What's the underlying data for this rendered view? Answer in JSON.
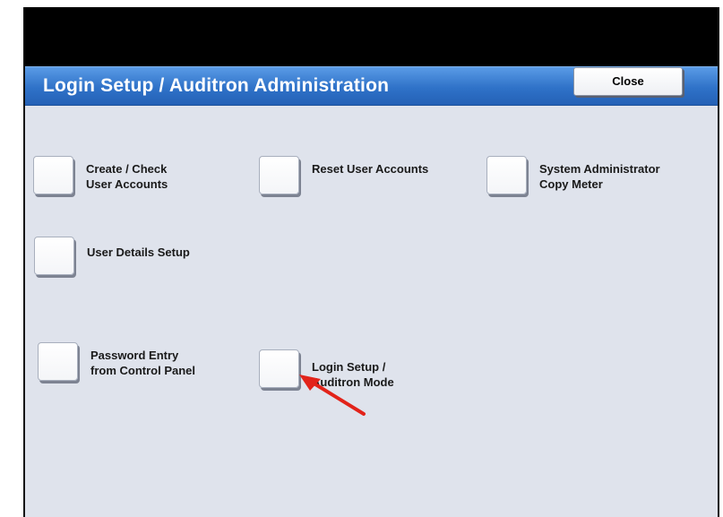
{
  "window": {
    "title": "Login Setup / Auditron Administration",
    "close_label": "Close"
  },
  "options": [
    {
      "label": "Create / Check\nUser Accounts"
    },
    {
      "label": "Reset User Accounts"
    },
    {
      "label": "System Administrator\nCopy Meter"
    },
    {
      "label": "User Details Setup"
    },
    {
      "label": "Password Entry\nfrom Control Panel"
    },
    {
      "label": "Login Setup /\nAuditron Mode"
    }
  ],
  "annotation": {
    "arrow_color": "#e2231a",
    "arrow_target": "Login Setup / Auditron Mode"
  }
}
